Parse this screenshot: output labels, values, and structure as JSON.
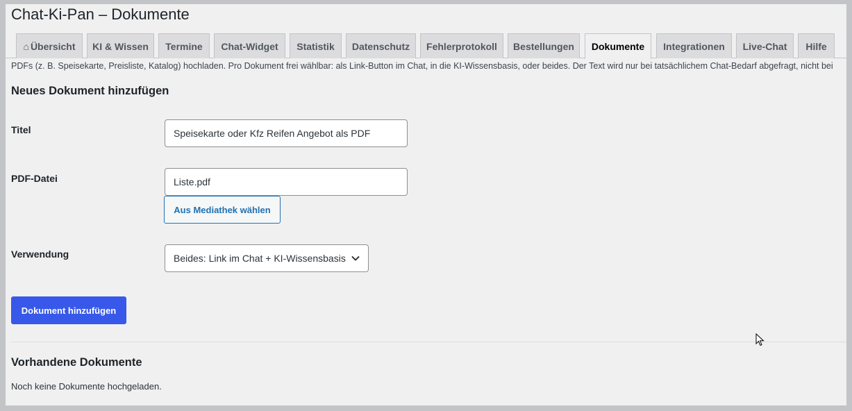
{
  "page": {
    "title": "Chat-Ki-Pan – Dokumente",
    "intro": "PDFs (z. B. Speisekarte, Preisliste, Katalog) hochladen. Pro Dokument frei wählbar: als Link-Button im Chat, in die KI-Wissensbasis, oder beides. Der Text wird nur bei tatsächlichem Chat-Bedarf abgefragt, nicht bei"
  },
  "tabs": [
    {
      "label": "Übersicht",
      "icon": "home-icon",
      "glyph": "⌂"
    },
    {
      "label": "KI & Wissen"
    },
    {
      "label": "Termine"
    },
    {
      "label": "Chat-Widget"
    },
    {
      "label": "Statistik"
    },
    {
      "label": "Datenschutz"
    },
    {
      "label": "Fehlerprotokoll"
    },
    {
      "label": "Bestellungen"
    },
    {
      "label": "Dokumente",
      "active": true
    },
    {
      "label": "Integrationen"
    },
    {
      "label": "Live-Chat"
    },
    {
      "label": "Hilfe"
    }
  ],
  "form": {
    "heading": "Neues Dokument hinzufügen",
    "title_label": "Titel",
    "title_value": "Speisekarte oder Kfz Reifen Angebot als PDF",
    "file_label": "PDF-Datei",
    "file_value": "Liste.pdf",
    "media_button": "Aus Mediathek wählen",
    "usage_label": "Verwendung",
    "usage_selected": "Beides: Link im Chat + KI-Wissensbasis",
    "submit_button": "Dokument hinzufügen"
  },
  "existing": {
    "heading": "Vorhandene Dokumente",
    "empty_text": "Noch keine Dokumente hochgeladen."
  },
  "colors": {
    "primary": "#3858e9",
    "link": "#2271b1",
    "background": "#f0f0f1"
  }
}
